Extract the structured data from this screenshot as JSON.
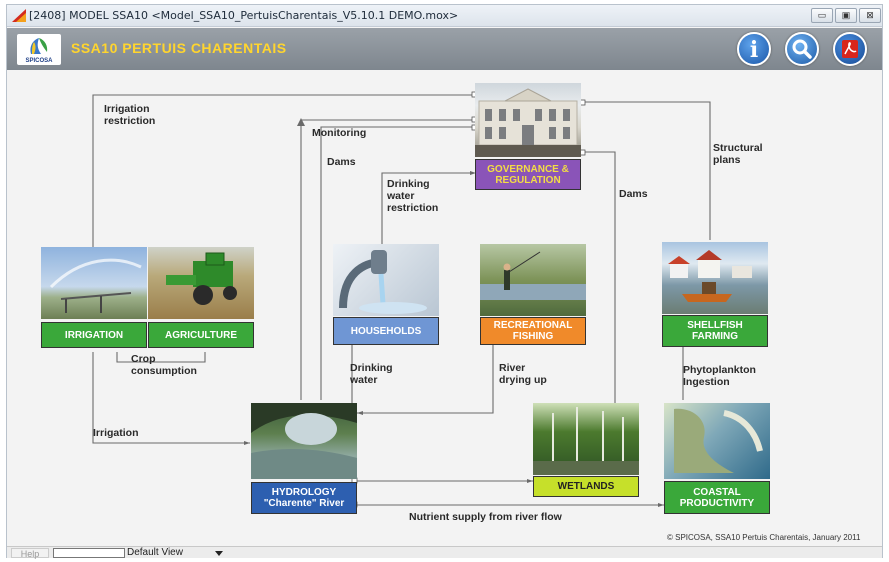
{
  "window": {
    "title": "[2408]  MODEL SSA10   <Model_SSA10_PertuisCharentais_V5.10.1 DEMO.mox>",
    "minimize": "▭",
    "maximize": "▣",
    "close": "⊠"
  },
  "header": {
    "logo_text": "SPICOSA",
    "title": "SSA10 PERTUIS CHARENTAIS",
    "info_icon": "i"
  },
  "nodes": {
    "irrigation": "IRRIGATION",
    "agriculture": "AGRICULTURE",
    "households": "HOUSEHOLDS",
    "recreational_fishing": "RECREATIONAL FISHING",
    "shellfish_farming": "SHELLFISH FARMING",
    "governance": "GOVERNANCE & REGULATION",
    "hydrology_1": "HYDROLOGY",
    "hydrology_2": "\"Charente\" River",
    "wetlands": "WETLANDS",
    "coastal_productivity": "COASTAL PRODUCTIVITY"
  },
  "labels": {
    "irrigation_restriction": "Irrigation restriction",
    "monitoring": "Monitoring",
    "dams_left": "Dams",
    "drinking_water_restriction": "Drinking water restriction",
    "structural_plans": "Structural plans",
    "dams_right": "Dams",
    "crop_consumption": "Crop consumption",
    "drinking_water": "Drinking water",
    "river_drying_up": "River drying up",
    "phytoplankton_ingestion": "Phytoplankton Ingestion",
    "irrigation_link": "Irrigation",
    "nutrient_supply": "Nutrient supply from river flow"
  },
  "copyright": "© SPICOSA, SSA10 Pertuis Charentais, January 2011",
  "statusbar": {
    "help": "Help",
    "view": "Default View"
  },
  "colors": {
    "green": "#3aa83a",
    "blue": "#5b86c8",
    "orange": "#f08a2a",
    "purple": "#8a54b8",
    "dark_blue": "#2d5fb0",
    "yellow_green": "#c6e02a",
    "header_title": "#ffd52e"
  }
}
